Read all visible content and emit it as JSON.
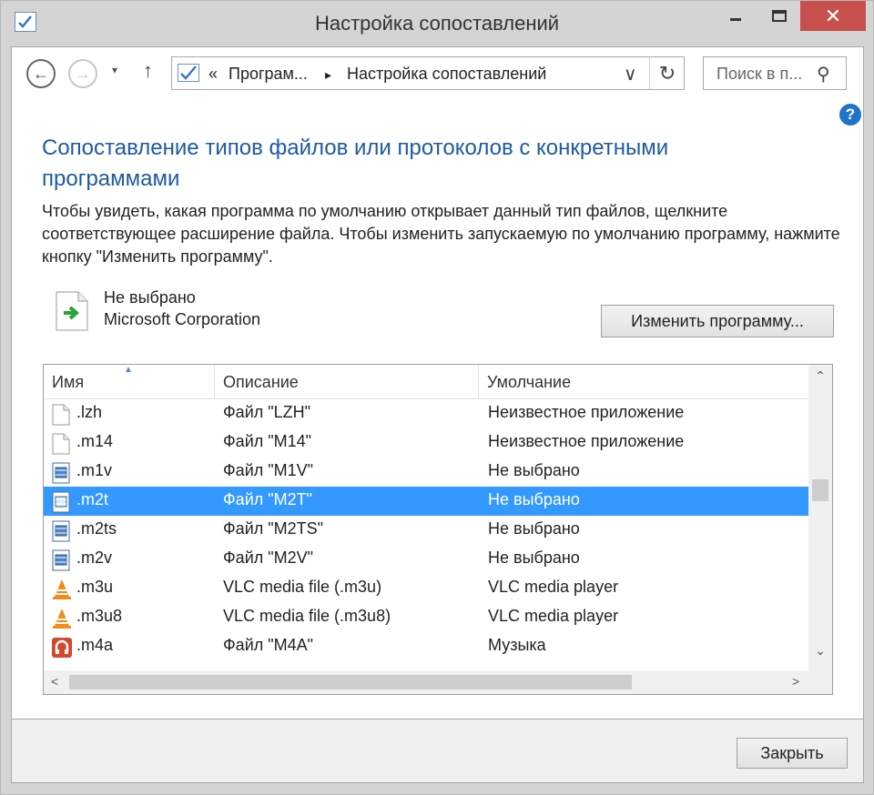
{
  "window": {
    "title": "Настройка сопоставлений",
    "close_glyph": "✕"
  },
  "nav": {
    "back_glyph": "←",
    "forward_glyph": "→",
    "dropdown_glyph": "▾",
    "up_glyph": "↑"
  },
  "address": {
    "crumb_prefix": "«",
    "crumb_programs": "Програм...",
    "crumb_sep": "▸",
    "crumb_current": "Настройка сопоставлений",
    "chevron_glyph": "∨",
    "refresh_glyph": "↻"
  },
  "search": {
    "placeholder": "Поиск в п...",
    "icon_glyph": "⚲"
  },
  "help": {
    "glyph": "?"
  },
  "main": {
    "heading": "Сопоставление типов файлов или протоколов с конкретными программами",
    "description": "Чтобы увидеть, какая программа по умолчанию открывает данный тип файлов, щелкните соответствующее расширение файла. Чтобы изменить запускаемую по умолчанию программу, нажмите кнопку \"Изменить программу\"."
  },
  "current": {
    "name": "Не выбрано",
    "company": "Microsoft Corporation",
    "change_button": "Изменить программу..."
  },
  "list": {
    "columns": [
      "Имя",
      "Описание",
      "Умолчание"
    ],
    "sort_glyph": "▲",
    "rows": [
      {
        "icon": "document-icon",
        "ext": ".lzh",
        "desc": "Файл \"LZH\"",
        "default": "Неизвестное приложение",
        "selected": false
      },
      {
        "icon": "document-icon",
        "ext": ".m14",
        "desc": "Файл \"M14\"",
        "default": "Неизвестное приложение",
        "selected": false
      },
      {
        "icon": "video-file-icon",
        "ext": ".m1v",
        "desc": "Файл \"M1V\"",
        "default": "Не выбрано",
        "selected": false
      },
      {
        "icon": "video-file-icon",
        "ext": ".m2t",
        "desc": "Файл \"M2T\"",
        "default": "Не выбрано",
        "selected": true
      },
      {
        "icon": "video-file-icon",
        "ext": ".m2ts",
        "desc": "Файл \"M2TS\"",
        "default": "Не выбрано",
        "selected": false
      },
      {
        "icon": "video-file-icon",
        "ext": ".m2v",
        "desc": "Файл \"M2V\"",
        "default": "Не выбрано",
        "selected": false
      },
      {
        "icon": "vlc-cone-icon",
        "ext": ".m3u",
        "desc": "VLC media file (.m3u)",
        "default": "VLC media player",
        "selected": false
      },
      {
        "icon": "vlc-cone-icon",
        "ext": ".m3u8",
        "desc": "VLC media file (.m3u8)",
        "default": "VLC media player",
        "selected": false
      },
      {
        "icon": "music-icon",
        "ext": ".m4a",
        "desc": "Файл \"M4A\"",
        "default": "Музыка",
        "selected": false
      }
    ],
    "scroll_up": "⌃",
    "scroll_down": "⌄",
    "scroll_left": "<",
    "scroll_right": ">"
  },
  "footer": {
    "close_button": "Закрыть"
  },
  "colors": {
    "heading": "#1e5aa3",
    "selection": "#3399ff",
    "close_red": "#c7504c"
  }
}
